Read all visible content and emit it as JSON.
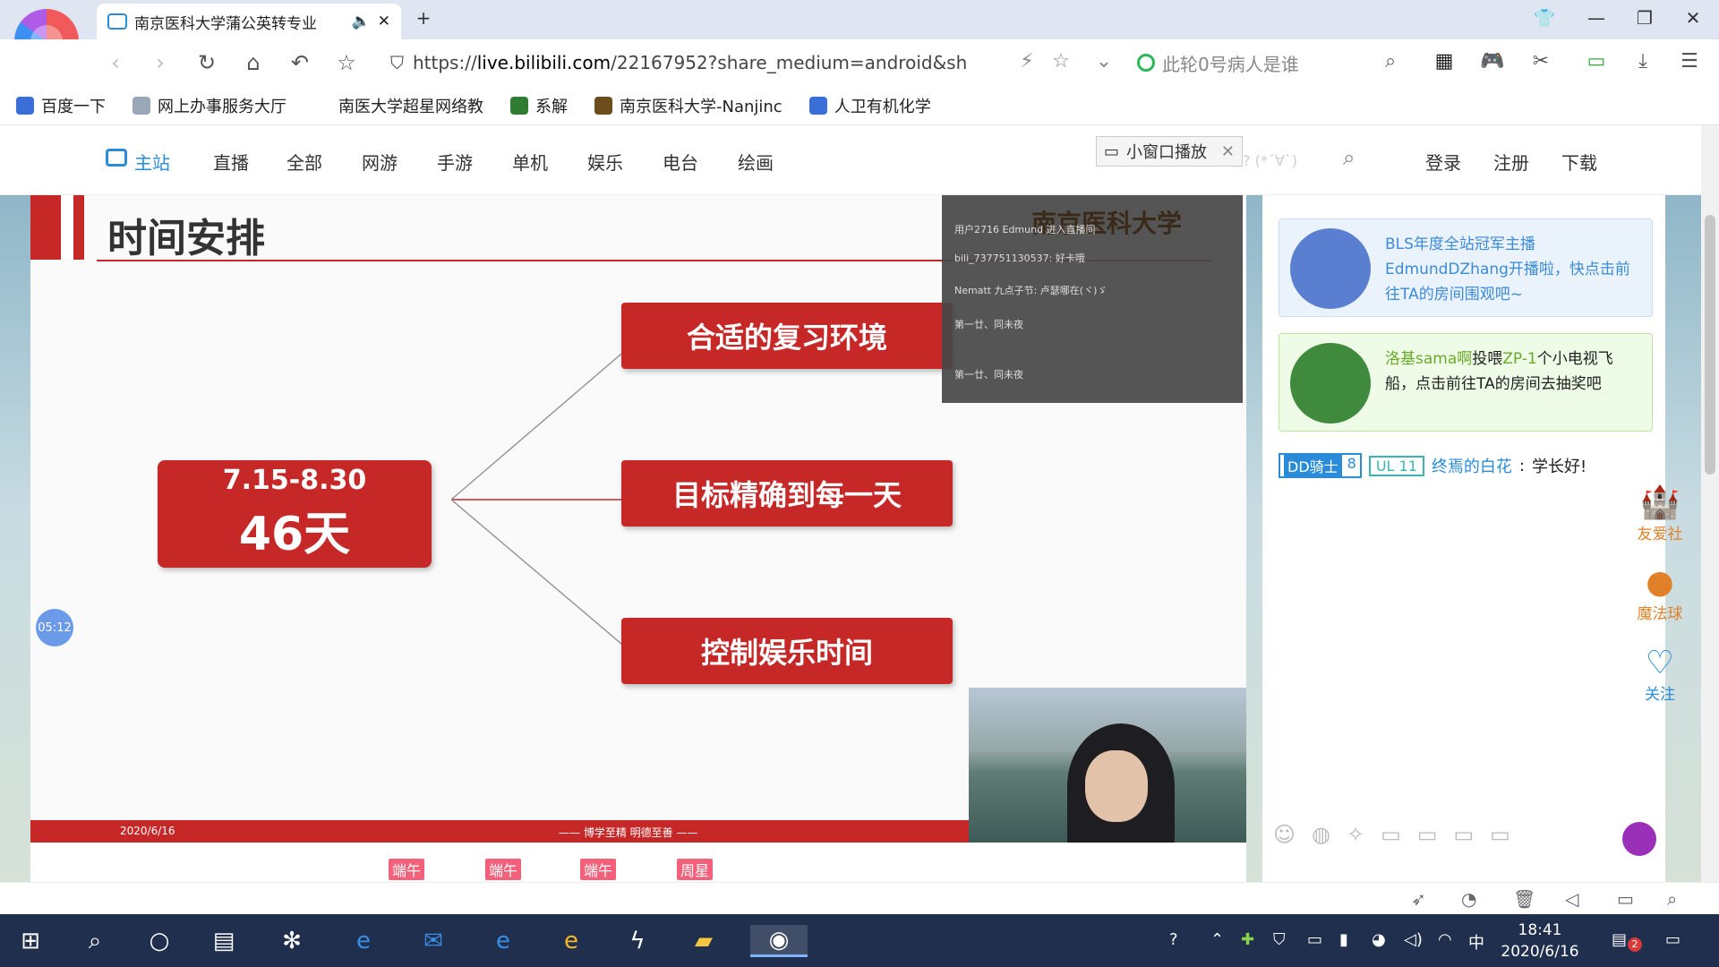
{
  "tab": {
    "title": "南京医科大学蒲公英转专业",
    "mute_icon": "speaker-icon",
    "close_glyph": "✕",
    "new_tab_glyph": "+"
  },
  "window": {
    "shirt_icon": "skin-icon",
    "minimize": "—",
    "restore": "❐",
    "close": "✕"
  },
  "address": {
    "url_prefix": "https://",
    "url_host": "live.bilibili.com",
    "url_path": "/22167952?share_medium=android&sh",
    "search_text": "此轮0号病人是谁"
  },
  "bookmarks": [
    {
      "label": "百度一下",
      "color": "#3b6fd8"
    },
    {
      "label": "网上办事服务大厅",
      "color": "#9aa7b8"
    },
    {
      "label": "南医大学超星网络教",
      "color": "#ffffff"
    },
    {
      "label": "系解",
      "color": "#2e7d32"
    },
    {
      "label": "南京医科大学-Nanjinc",
      "color": "#6d4c1d"
    },
    {
      "label": "人卫有机化学",
      "color": "#3b6fd8"
    }
  ],
  "site_nav": {
    "items": [
      "主站",
      "直播",
      "全部",
      "网游",
      "手游",
      "单机",
      "娱乐",
      "电台",
      "绘画"
    ],
    "mini_play": "小窗口播放",
    "search_placeholder": "啊? (*´∀`)",
    "login": "登录",
    "register": "注册",
    "download": "下载"
  },
  "slide": {
    "title": "时间安排",
    "date_range": "7.15-8.30",
    "days": "46天",
    "item1": "合适的复习环境",
    "item2": "目标精确到每一天",
    "item3": "控制娱乐时间",
    "footer_date": "2020/6/16",
    "footer_motto": "—— 博学至精  明德至善 ——",
    "watermark": "南京医科大学"
  },
  "timer": "05:12",
  "chat_overlay": [
    "用户2716 Edmund 进入直播间",
    "bili_737751130537: 好卡哦",
    "Nematt 九点子节: 卢瑟哪在(ヾ)ゞ",
    "第一廿、同未夜",
    "第一廿、同未夜"
  ],
  "notices": {
    "n1": "BLS年度全站冠军主播EdmundDZhang开播啦，快点击前往TA的房间围观吧~",
    "n2_name": "洛基sama啊",
    "n2_verb": "投喂",
    "n2_target": "ZP-1",
    "n2_rest": "个小电视飞船，点击前往TA的房间去抽奖吧"
  },
  "chat": {
    "medal_name": "DD骑士",
    "medal_level": "8",
    "ul": "UL 11",
    "user": "终焉的白花",
    "message": "学长好!"
  },
  "float_widgets": [
    {
      "label": "友爱社",
      "icon": "castle-icon"
    },
    {
      "label": "魔法球",
      "icon": "magic-ball-icon"
    },
    {
      "label": "关注",
      "icon": "heart-icon"
    }
  ],
  "gifts": [
    "端午",
    "端午",
    "端午",
    "周星"
  ],
  "taskbar": {
    "time": "18:41",
    "date": "2020/6/16",
    "ime": "中",
    "notification_count": "2"
  }
}
